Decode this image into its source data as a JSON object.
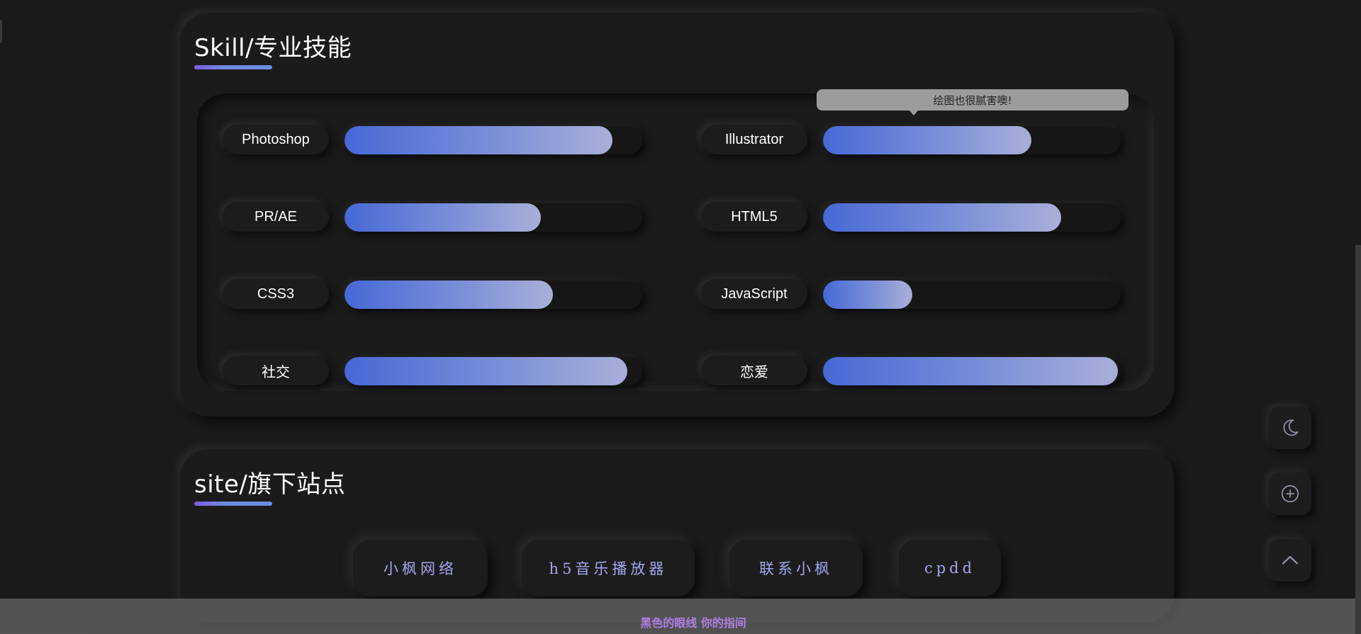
{
  "skill_section": {
    "title": "Skill/专业技能",
    "tooltip": "绘图也很腻害噢!",
    "skills": [
      {
        "label": "Photoshop",
        "level": 0.9
      },
      {
        "label": "Illustrator",
        "level": 0.7
      },
      {
        "label": "PR/AE",
        "level": 0.66
      },
      {
        "label": "HTML5",
        "level": 0.8
      },
      {
        "label": "CSS3",
        "level": 0.7
      },
      {
        "label": "JavaScript",
        "level": 0.3
      },
      {
        "label": "社交",
        "level": 0.95
      },
      {
        "label": "恋爱",
        "level": 0.99
      }
    ]
  },
  "site_section": {
    "title": "site/旗下站点",
    "links": [
      "小枫网络",
      "h5音乐播放器",
      "联系小枫",
      "cpdd"
    ]
  },
  "float_buttons": [
    {
      "icon": "moon-icon"
    },
    {
      "icon": "plus-circle-icon"
    },
    {
      "icon": "chevron-up-icon"
    }
  ],
  "footer": {
    "text": "黑色的眼线 你的指间"
  },
  "colors": {
    "background": "#1a1a1a",
    "bar_start": "#4669d6",
    "bar_end": "#a9afd9",
    "link_text": "#a3a6ee",
    "footer_text": "#b07fe8"
  }
}
